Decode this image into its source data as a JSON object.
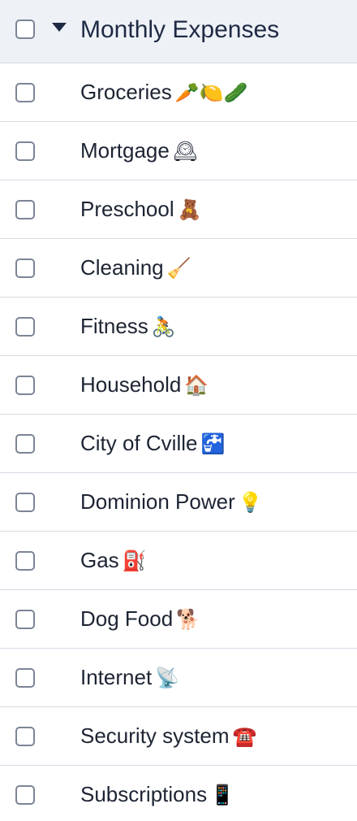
{
  "group": {
    "title": "Monthly Expenses"
  },
  "items": [
    {
      "label": "Groceries",
      "emoji": "🥕🍋🥒"
    },
    {
      "label": "Mortgage",
      "emoji": "🕰"
    },
    {
      "label": "Preschool",
      "emoji": "🧸"
    },
    {
      "label": "Cleaning",
      "emoji": "🧹"
    },
    {
      "label": "Fitness",
      "emoji": "🚴"
    },
    {
      "label": "Household",
      "emoji": "🏠"
    },
    {
      "label": "City of Cville",
      "emoji": "🚰"
    },
    {
      "label": "Dominion Power",
      "emoji": "💡"
    },
    {
      "label": "Gas",
      "emoji": "⛽"
    },
    {
      "label": "Dog Food",
      "emoji": "🐕"
    },
    {
      "label": "Internet",
      "emoji": "📡"
    },
    {
      "label": "Security system",
      "emoji": "☎️"
    },
    {
      "label": "Subscriptions",
      "emoji": "📱"
    }
  ]
}
